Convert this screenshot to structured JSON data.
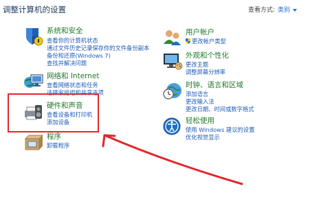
{
  "header": {
    "title": "调整计算机的设置",
    "view_by_label": "查看方式:",
    "view_by_value": "类别"
  },
  "left_categories": [
    {
      "icon": "security-shield-icon",
      "title": "系统和安全",
      "links": [
        "查看你的计算机状态",
        "通过文件历史记录保存你的文件备份副本",
        "备份和还原(Windows 7)",
        "查找并解决问题"
      ]
    },
    {
      "icon": "network-globe-icon",
      "title": "网络和 Internet",
      "links": [
        "查看网络状态和任务",
        "选择家庭组和共享选项"
      ]
    },
    {
      "icon": "printer-speaker-icon",
      "title": "硬件和声音",
      "links": [
        "查看设备和打印机",
        "添加设备"
      ]
    },
    {
      "icon": "programs-box-icon",
      "title": "程序",
      "links": [
        "卸载程序"
      ]
    }
  ],
  "right_categories": [
    {
      "icon": "user-accounts-icon",
      "title": "用户帐户",
      "links": [
        "更改帐户类型"
      ]
    },
    {
      "icon": "appearance-monitor-icon",
      "title": "外观和个性化",
      "links": [
        "更改主题",
        "调整屏幕分辨率"
      ]
    },
    {
      "icon": "clock-globe-icon",
      "title": "时钟、语言和区域",
      "links": [
        "添加语言",
        "更改输入法",
        "更改日期、时间或数字格式"
      ]
    },
    {
      "icon": "ease-of-access-icon",
      "title": "轻松使用",
      "links": [
        "使用 Windows 建议的设置",
        "优化视觉显示"
      ]
    }
  ],
  "colors": {
    "heading": "#1f7a2a",
    "link": "#1e5bb8",
    "annotation": "#e3262d"
  }
}
